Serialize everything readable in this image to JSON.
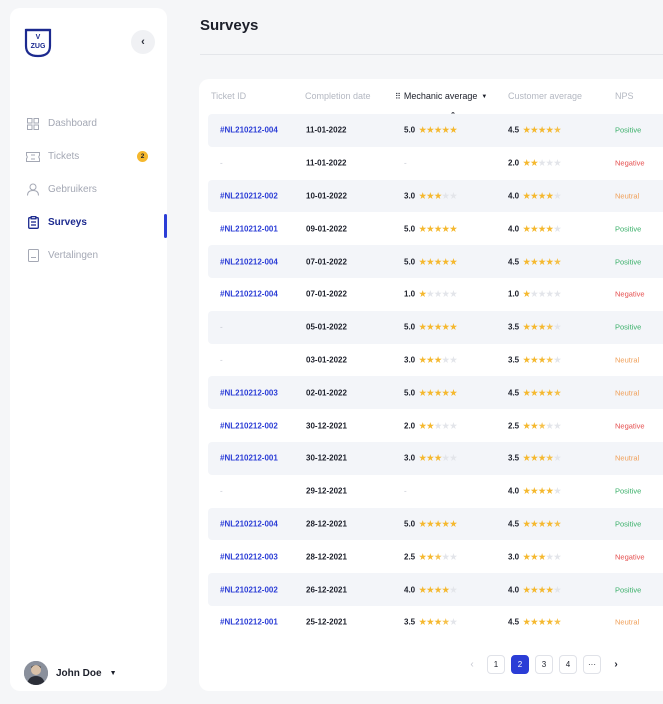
{
  "brand": {
    "logo_top": "V",
    "logo_bottom": "ZUG"
  },
  "sidebar": {
    "items": [
      {
        "label": "Dashboard",
        "icon": "grid-icon",
        "active": false
      },
      {
        "label": "Tickets",
        "icon": "ticket-icon",
        "active": false,
        "badge": "2"
      },
      {
        "label": "Gebruikers",
        "icon": "user-icon",
        "active": false
      },
      {
        "label": "Surveys",
        "icon": "clipboard-icon",
        "active": true
      },
      {
        "label": "Vertalingen",
        "icon": "document-icon",
        "active": false
      }
    ],
    "user": {
      "name": "John Doe"
    }
  },
  "page": {
    "title": "Surveys"
  },
  "table": {
    "columns": {
      "ticket_id": "Ticket ID",
      "completion_date": "Completion date",
      "mechanic_average": "Mechanic average",
      "customer_average": "Customer average",
      "nps": "NPS"
    },
    "rows": [
      {
        "ticket": "#NL210212-004",
        "date": "11-01-2022",
        "mech": "5.0",
        "mech_stars": 5,
        "cust": "4.5",
        "cust_stars": 4.5,
        "nps": "Positive"
      },
      {
        "ticket": "-",
        "date": "11-01-2022",
        "mech": "-",
        "mech_stars": null,
        "cust": "2.0",
        "cust_stars": 2,
        "nps": "Negative"
      },
      {
        "ticket": "#NL210212-002",
        "date": "10-01-2022",
        "mech": "3.0",
        "mech_stars": 3,
        "cust": "4.0",
        "cust_stars": 4,
        "nps": "Neutral"
      },
      {
        "ticket": "#NL210212-001",
        "date": "09-01-2022",
        "mech": "5.0",
        "mech_stars": 5,
        "cust": "4.0",
        "cust_stars": 4,
        "nps": "Positive"
      },
      {
        "ticket": "#NL210212-004",
        "date": "07-01-2022",
        "mech": "5.0",
        "mech_stars": 5,
        "cust": "4.5",
        "cust_stars": 4.5,
        "nps": "Positive"
      },
      {
        "ticket": "#NL210212-004",
        "date": "07-01-2022",
        "mech": "1.0",
        "mech_stars": 1,
        "cust": "1.0",
        "cust_stars": 1,
        "nps": "Negative"
      },
      {
        "ticket": "-",
        "date": "05-01-2022",
        "mech": "5.0",
        "mech_stars": 5,
        "cust": "3.5",
        "cust_stars": 3.5,
        "nps": "Positive"
      },
      {
        "ticket": "-",
        "date": "03-01-2022",
        "mech": "3.0",
        "mech_stars": 3,
        "cust": "3.5",
        "cust_stars": 3.5,
        "nps": "Neutral"
      },
      {
        "ticket": "#NL210212-003",
        "date": "02-01-2022",
        "mech": "5.0",
        "mech_stars": 5,
        "cust": "4.5",
        "cust_stars": 4.5,
        "nps": "Neutral"
      },
      {
        "ticket": "#NL210212-002",
        "date": "30-12-2021",
        "mech": "2.0",
        "mech_stars": 2,
        "cust": "2.5",
        "cust_stars": 2.5,
        "nps": "Negative"
      },
      {
        "ticket": "#NL210212-001",
        "date": "30-12-2021",
        "mech": "3.0",
        "mech_stars": 3,
        "cust": "3.5",
        "cust_stars": 3.5,
        "nps": "Neutral"
      },
      {
        "ticket": "-",
        "date": "29-12-2021",
        "mech": "-",
        "mech_stars": null,
        "cust": "4.0",
        "cust_stars": 4,
        "nps": "Positive"
      },
      {
        "ticket": "#NL210212-004",
        "date": "28-12-2021",
        "mech": "5.0",
        "mech_stars": 5,
        "cust": "4.5",
        "cust_stars": 4.5,
        "nps": "Positive"
      },
      {
        "ticket": "#NL210212-003",
        "date": "28-12-2021",
        "mech": "2.5",
        "mech_stars": 2.5,
        "cust": "3.0",
        "cust_stars": 3,
        "nps": "Negative"
      },
      {
        "ticket": "#NL210212-002",
        "date": "26-12-2021",
        "mech": "4.0",
        "mech_stars": 4,
        "cust": "4.0",
        "cust_stars": 4,
        "nps": "Positive"
      },
      {
        "ticket": "#NL210212-001",
        "date": "25-12-2021",
        "mech": "3.5",
        "mech_stars": 3.5,
        "cust": "4.5",
        "cust_stars": 4.5,
        "nps": "Neutral"
      }
    ]
  },
  "pagination": {
    "pages": [
      "1",
      "2",
      "3",
      "4",
      "···"
    ],
    "current": "2"
  },
  "colors": {
    "accent": "#2b3dd6",
    "star": "#f5b82e",
    "positive": "#3bb06a",
    "negative": "#e55151",
    "neutral": "#f0a05a"
  }
}
